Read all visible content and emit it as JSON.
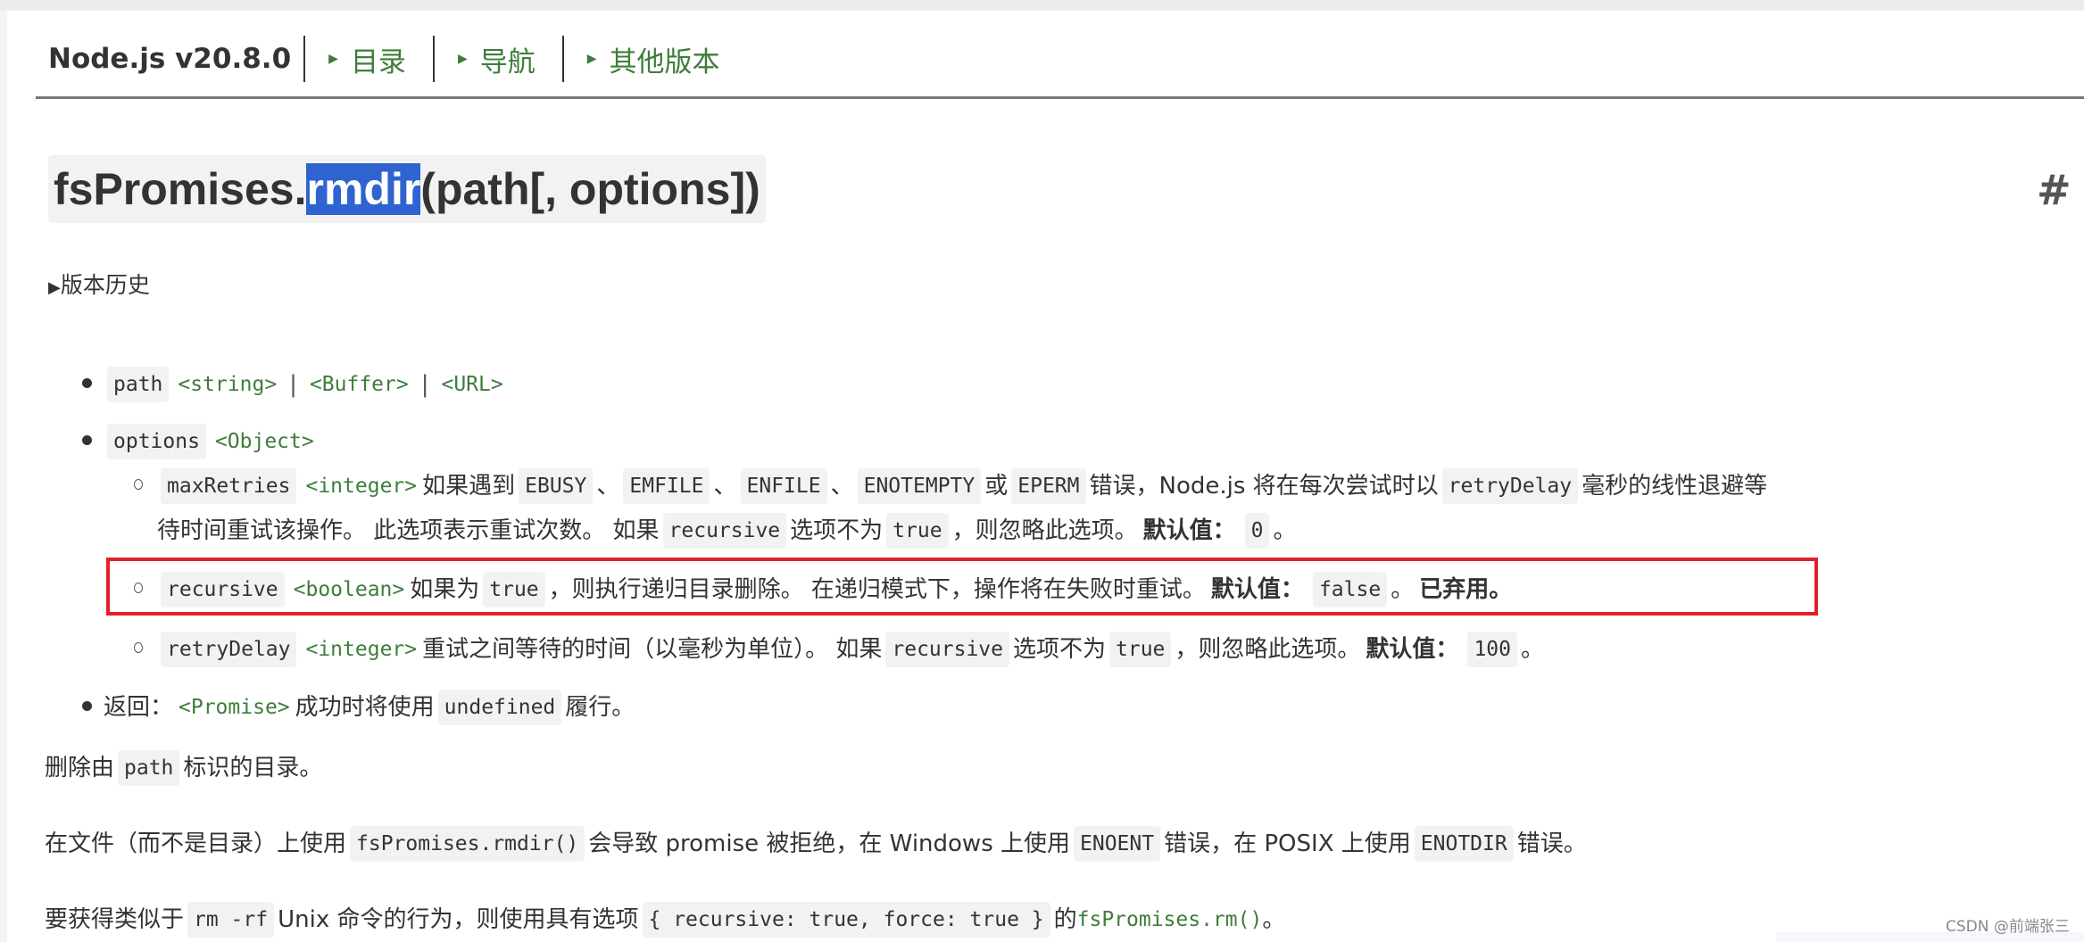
{
  "header": {
    "version": "Node.js v20.8.0",
    "nav": [
      {
        "label": "目录"
      },
      {
        "label": "导航"
      },
      {
        "label": "其他版本"
      }
    ]
  },
  "title": {
    "prefix": "fsPromises.",
    "selected": "rmdir",
    "suffix": "(path[, options])",
    "anchor": "#"
  },
  "history": {
    "label": "版本历史"
  },
  "params": {
    "path": {
      "name": "path",
      "types": [
        "<string>",
        "<Buffer>",
        "<URL>"
      ],
      "sep": "|"
    },
    "options": {
      "name": "options",
      "type": "<Object>"
    },
    "maxRetries": {
      "name": "maxRetries",
      "type": "<integer>",
      "t1": "如果遇到",
      "c1": "EBUSY",
      "d1": "、",
      "c2": "EMFILE",
      "d2": "、",
      "c3": "ENFILE",
      "d3": "、",
      "c4": "ENOTEMPTY",
      "t2": "或",
      "c5": "EPERM",
      "t3": "错误，Node.js 将在每次尝试时以",
      "c6": "retryDelay",
      "t4": "毫秒的线性退避等",
      "t5": "待时间重试该操作。 此选项表示重试次数。 如果",
      "c7": "recursive",
      "t6": "选项不为",
      "c8": "true",
      "t7": "，则忽略此选项。",
      "default_label": "默认值：",
      "default": "0",
      "end": "。"
    },
    "recursive": {
      "name": "recursive",
      "type": "<boolean>",
      "t1": "如果为",
      "c1": "true",
      "t2": "，则执行递归目录删除。 在递归模式下，操作将在失败时重试。",
      "default_label": "默认值：",
      "default": "false",
      "t3": "。",
      "deprecated": "已弃用。"
    },
    "retryDelay": {
      "name": "retryDelay",
      "type": "<integer>",
      "t1": "重试之间等待的时间（以毫秒为单位）。 如果",
      "c1": "recursive",
      "t2": "选项不为",
      "c2": "true",
      "t3": "，则忽略此选项。",
      "default_label": "默认值：",
      "default": "100",
      "end": "。"
    },
    "returns": {
      "label": "返回：",
      "type": "<Promise>",
      "t1": "成功时将使用",
      "c1": "undefined",
      "t2": "履行。"
    }
  },
  "paragraphs": {
    "p1": {
      "t1": "删除由",
      "c1": "path",
      "t2": "标识的目录。"
    },
    "p2": {
      "t1": "在文件（而不是目录）上使用",
      "c1": "fsPromises.rmdir()",
      "t2": "会导致 promise 被拒绝，在 Windows 上使用",
      "c2": "ENOENT",
      "t3": "错误，在 POSIX 上使用",
      "c3": "ENOTDIR",
      "t4": "错误。"
    },
    "p3": {
      "t1": "要获得类似于",
      "c1": "rm -rf",
      "t2": "Unix 命令的行为，则使用具有选项",
      "c2": "{ recursive: true, force: true }",
      "t3": "的",
      "link": "fsPromises.rm()",
      "t4": "。"
    }
  },
  "watermark": "CSDN @前端张三",
  "colors": {
    "link": "#3e7d3a",
    "selection": "#2f64d0",
    "highlight_box": "#e0202a",
    "code_bg": "#f2f2f2"
  }
}
